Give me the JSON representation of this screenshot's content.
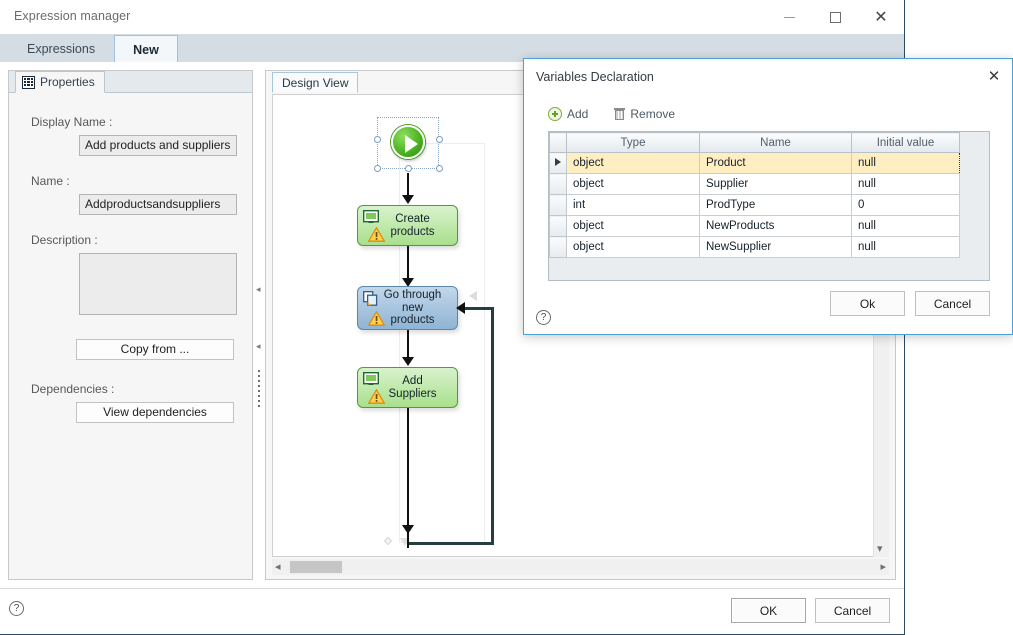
{
  "window": {
    "title": "Expression manager",
    "controls": {
      "minimize": "–",
      "maximize": "□",
      "close": "✕"
    },
    "tabs": [
      {
        "label": "Expressions",
        "active": false
      },
      {
        "label": "New",
        "active": true
      }
    ],
    "footer": {
      "help": "?",
      "ok_label": "OK",
      "cancel_label": "Cancel"
    }
  },
  "properties": {
    "tab_label": "Properties",
    "display_name": {
      "label": "Display Name :",
      "value": "Add products and suppliers"
    },
    "name": {
      "label": "Name :",
      "value": "Addproductsandsuppliers"
    },
    "description": {
      "label": "Description :",
      "value": ""
    },
    "copy_from_label": "Copy from ...",
    "dependencies": {
      "label": "Dependencies :",
      "button_label": "View dependencies"
    }
  },
  "design_view": {
    "tab_label": "Design View",
    "nodes": [
      {
        "id": "start",
        "type": "start",
        "label": "",
        "selected": true
      },
      {
        "id": "create-products",
        "type": "activity",
        "color": "green",
        "label": "Create\nproducts",
        "icon": "screen-icon",
        "warning": true
      },
      {
        "id": "go-through-new-products",
        "type": "activity",
        "color": "blue",
        "label": "Go through\nnew\nproducts",
        "icon": "copy-icon",
        "warning": true
      },
      {
        "id": "add-suppliers",
        "type": "activity",
        "color": "green",
        "label": "Add\nSuppliers",
        "icon": "screen-icon",
        "warning": true
      }
    ],
    "scrollbars": {
      "horizontal": true,
      "vertical": true
    }
  },
  "vars_dialog": {
    "title": "Variables Declaration",
    "close_label": "✕",
    "toolbar": {
      "add_label": "Add",
      "remove_label": "Remove"
    },
    "table": {
      "columns": [
        "Type",
        "Name",
        "Initial value"
      ],
      "rows": [
        {
          "type": "object",
          "name": "Product",
          "initial_value": "null",
          "selected": true
        },
        {
          "type": "object",
          "name": "Supplier",
          "initial_value": "null",
          "selected": false
        },
        {
          "type": "int",
          "name": "ProdType",
          "initial_value": "0",
          "selected": false
        },
        {
          "type": "object",
          "name": "NewProducts",
          "initial_value": "null",
          "selected": false
        },
        {
          "type": "object",
          "name": "NewSupplier",
          "initial_value": "null",
          "selected": false
        }
      ]
    },
    "ok_label": "Ok",
    "cancel_label": "Cancel",
    "help": "?"
  },
  "colors": {
    "accent": "#4aa0d5",
    "tabstrip": "#d4dde4",
    "selected_row": "#ffeec2",
    "node_green": "#a8e08c",
    "node_blue": "#8fb4d4",
    "start_green": "#48b01e"
  }
}
